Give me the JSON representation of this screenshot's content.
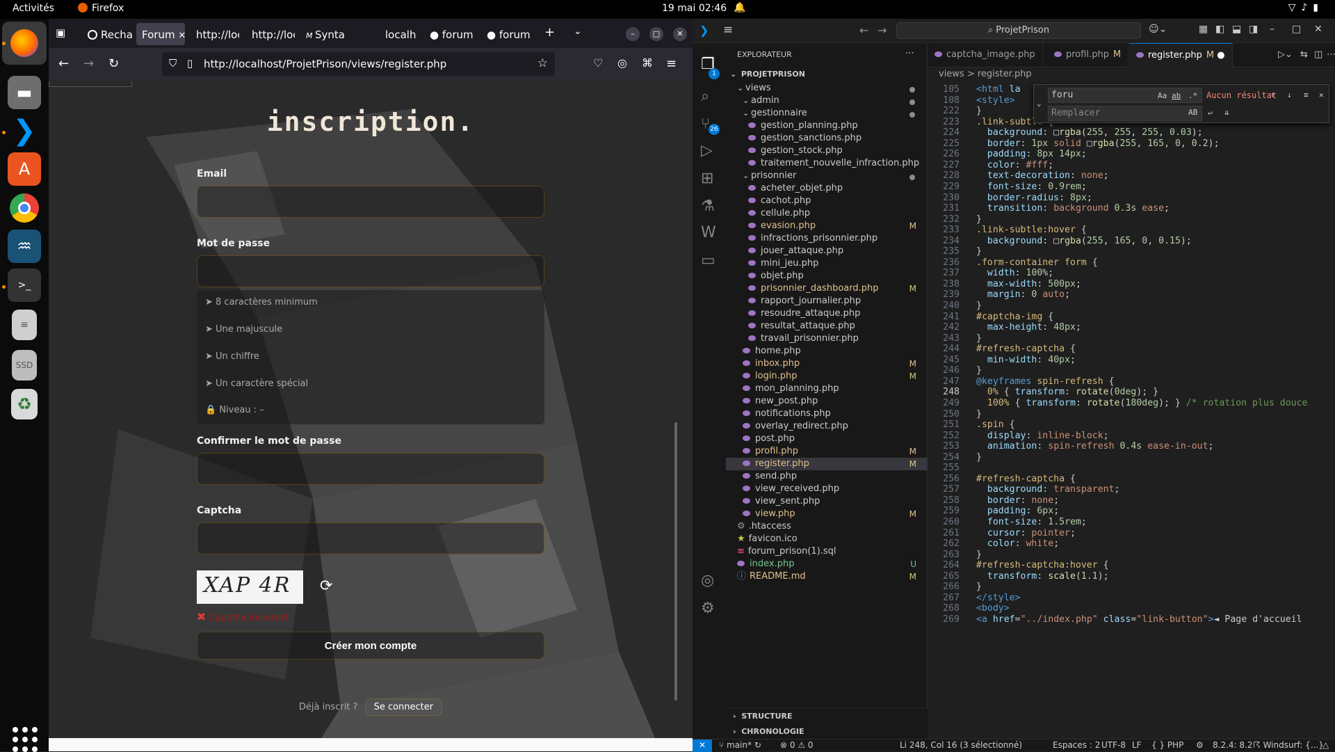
{
  "topbar": {
    "activities": "Activités",
    "app": "Firefox",
    "clock": "19 mai  02:46"
  },
  "firefox": {
    "tabs": [
      {
        "label": "Recha"
      },
      {
        "label": "Forum"
      },
      {
        "label": "http://loc"
      },
      {
        "label": "http://loc"
      },
      {
        "label": "Synta"
      },
      {
        "label": "localh"
      },
      {
        "label": "forum"
      },
      {
        "label": "forum"
      }
    ],
    "url": "http://localhost/ProjetPrison/views/register.php"
  },
  "page": {
    "title": "inscription.",
    "email_label": "Email",
    "password_label": "Mot de passe",
    "rules": [
      "8 caractères minimum",
      "Une majuscule",
      "Un chiffre",
      "Un caractère spécial"
    ],
    "level": "Niveau : –",
    "confirm_label": "Confirmer le mot de passe",
    "captcha_label": "Captcha",
    "captcha_text": "XAP 4R",
    "captcha_error": "Captcha incorrect",
    "submit": "Créer mon compte",
    "already": "Déjà inscrit ?",
    "login_link": "Se connecter"
  },
  "vscode": {
    "search": "ProjetPrison",
    "explorer_title": "EXPLORATEUR",
    "project": "PROJETPRISON",
    "tree": [
      {
        "name": "views",
        "type": "folder",
        "indent": 1
      },
      {
        "name": "admin",
        "type": "folder",
        "indent": 2
      },
      {
        "name": "gestionnaire",
        "type": "folder",
        "indent": 2
      },
      {
        "name": "gestion_planning.php",
        "indent": 3
      },
      {
        "name": "gestion_sanctions.php",
        "indent": 3
      },
      {
        "name": "gestion_stock.php",
        "indent": 3
      },
      {
        "name": "traitement_nouvelle_infraction.php",
        "indent": 3
      },
      {
        "name": "prisonnier",
        "type": "folder",
        "indent": 2
      },
      {
        "name": "acheter_objet.php",
        "indent": 3
      },
      {
        "name": "cachot.php",
        "indent": 3
      },
      {
        "name": "cellule.php",
        "indent": 3
      },
      {
        "name": "evasion.php",
        "indent": 3,
        "status": "M"
      },
      {
        "name": "infractions_prisonnier.php",
        "indent": 3
      },
      {
        "name": "jouer_attaque.php",
        "indent": 3
      },
      {
        "name": "mini_jeu.php",
        "indent": 3
      },
      {
        "name": "objet.php",
        "indent": 3
      },
      {
        "name": "prisonnier_dashboard.php",
        "indent": 3,
        "status": "M"
      },
      {
        "name": "rapport_journalier.php",
        "indent": 3
      },
      {
        "name": "resoudre_attaque.php",
        "indent": 3
      },
      {
        "name": "resultat_attaque.php",
        "indent": 3
      },
      {
        "name": "travail_prisonnier.php",
        "indent": 3
      },
      {
        "name": "home.php",
        "indent": 2
      },
      {
        "name": "inbox.php",
        "indent": 2,
        "status": "M"
      },
      {
        "name": "login.php",
        "indent": 2,
        "status": "M"
      },
      {
        "name": "mon_planning.php",
        "indent": 2
      },
      {
        "name": "new_post.php",
        "indent": 2
      },
      {
        "name": "notifications.php",
        "indent": 2
      },
      {
        "name": "overlay_redirect.php",
        "indent": 2
      },
      {
        "name": "post.php",
        "indent": 2
      },
      {
        "name": "profil.php",
        "indent": 2,
        "status": "M"
      },
      {
        "name": "register.php",
        "indent": 2,
        "status": "M",
        "selected": true
      },
      {
        "name": "send.php",
        "indent": 2
      },
      {
        "name": "view_received.php",
        "indent": 2
      },
      {
        "name": "view_sent.php",
        "indent": 2
      },
      {
        "name": "view.php",
        "indent": 2,
        "status": "M"
      },
      {
        "name": ".htaccess",
        "indent": 1
      },
      {
        "name": "favicon.ico",
        "indent": 1
      },
      {
        "name": "forum_prison(1).sql",
        "indent": 1
      },
      {
        "name": "index.php",
        "indent": 1,
        "status": "U"
      },
      {
        "name": "README.md",
        "indent": 1,
        "status": "M"
      }
    ],
    "editor_tabs": [
      {
        "label": "captcha_image.php"
      },
      {
        "label": "profil.php",
        "mod": "M"
      },
      {
        "label": "register.php",
        "mod": "M"
      }
    ],
    "breadcrumb": "views  >  register.php",
    "find": {
      "query": "foru",
      "replace": "Remplacer",
      "result": "Aucun résultat"
    },
    "sections": [
      "STRUCTURE",
      "CHRONOLOGIE"
    ],
    "status": {
      "branch": "main*",
      "problems": "0 ⚠ 0",
      "position": "Li 248, Col 16 (3 sélectionné)",
      "spaces": "Espaces : 2",
      "encoding": "UTF-8",
      "eol": "LF",
      "lang": "{ } PHP",
      "version": "8.2.4: 8.2",
      "windsurf": "Windsurf: {...}"
    },
    "code": [
      {
        "n": "105",
        "html": "<span class=\"t\">&lt;html</span> <span class=\"p\">la</span>"
      },
      {
        "n": "108",
        "html": "<span class=\"t\">&lt;style&gt;</span>"
      },
      {
        "n": "222",
        "html": "}"
      },
      {
        "n": "223",
        "html": "<span class=\"k\">.link-subtle</span> {"
      },
      {
        "n": "224",
        "html": "  <span class=\"p\">background</span>: □<span class=\"f\">rgba</span>(<span class=\"n\">255</span>, <span class=\"n\">255</span>, <span class=\"n\">255</span>, <span class=\"n\">0.03</span>);"
      },
      {
        "n": "225",
        "html": "  <span class=\"p\">border</span>: <span class=\"n\">1px</span> <span class=\"v\">solid</span> □<span class=\"f\">rgba</span>(<span class=\"n\">255</span>, <span class=\"n\">165</span>, <span class=\"n\">0</span>, <span class=\"n\">0.2</span>);"
      },
      {
        "n": "226",
        "html": "  <span class=\"p\">padding</span>: <span class=\"n\">8px 14px</span>;"
      },
      {
        "n": "227",
        "html": "  <span class=\"p\">color</span>: <span class=\"v\">#fff</span>;"
      },
      {
        "n": "228",
        "html": "  <span class=\"p\">text-decoration</span>: <span class=\"v\">none</span>;"
      },
      {
        "n": "229",
        "html": "  <span class=\"p\">font-size</span>: <span class=\"n\">0.9rem</span>;"
      },
      {
        "n": "230",
        "html": "  <span class=\"p\">border-radius</span>: <span class=\"n\">8px</span>;"
      },
      {
        "n": "231",
        "html": "  <span class=\"p\">transition</span>: <span class=\"v\">background</span> <span class=\"n\">0.3s</span> <span class=\"v\">ease</span>;"
      },
      {
        "n": "232",
        "html": "}"
      },
      {
        "n": "233",
        "html": "<span class=\"k\">.link-subtle:hover</span> {"
      },
      {
        "n": "234",
        "html": "  <span class=\"p\">background</span>: □<span class=\"f\">rgba</span>(<span class=\"n\">255</span>, <span class=\"n\">165</span>, <span class=\"n\">0</span>, <span class=\"n\">0.15</span>);"
      },
      {
        "n": "235",
        "html": "}"
      },
      {
        "n": "236",
        "html": "<span class=\"k\">.form-container form</span> {"
      },
      {
        "n": "237",
        "html": "  <span class=\"p\">width</span>: <span class=\"n\">100%</span>;"
      },
      {
        "n": "238",
        "html": "  <span class=\"p\">max-width</span>: <span class=\"n\">500px</span>;"
      },
      {
        "n": "239",
        "html": "  <span class=\"p\">margin</span>: <span class=\"n\">0</span> <span class=\"v\">auto</span>;"
      },
      {
        "n": "240",
        "html": "}"
      },
      {
        "n": "241",
        "html": "<span class=\"k\">#captcha-img</span> {"
      },
      {
        "n": "242",
        "html": "  <span class=\"p\">max-height</span>: <span class=\"n\">48px</span>;"
      },
      {
        "n": "243",
        "html": "}"
      },
      {
        "n": "244",
        "html": "<span class=\"k\">#refresh-captcha</span> {"
      },
      {
        "n": "245",
        "html": "  <span class=\"p\">min-width</span>: <span class=\"n\">40px</span>;"
      },
      {
        "n": "246",
        "html": "}"
      },
      {
        "n": "247",
        "html": "<span class=\"t\">@keyframes</span> <span class=\"k\">spin-refresh</span> {"
      },
      {
        "n": "248",
        "html": "  <span class=\"k\">0%</span> { <span class=\"p\">transform</span>: <span class=\"f\">rotate</span>(<span class=\"n\">0deg</span>); }",
        "cur": true
      },
      {
        "n": "249",
        "html": "  <span class=\"k\">100%</span> { <span class=\"p\">transform</span>: <span class=\"f\">rotate</span>(<span class=\"n\">180deg</span>); } <span class=\"c\">/* rotation plus douce</span>"
      },
      {
        "n": "250",
        "html": "}"
      },
      {
        "n": "251",
        "html": "<span class=\"k\">.spin</span> {"
      },
      {
        "n": "252",
        "html": "  <span class=\"p\">display</span>: <span class=\"v\">inline-block</span>;"
      },
      {
        "n": "253",
        "html": "  <span class=\"p\">animation</span>: <span class=\"v\">spin-refresh</span> <span class=\"n\">0.4s</span> <span class=\"v\">ease-in-out</span>;"
      },
      {
        "n": "254",
        "html": "}"
      },
      {
        "n": "255",
        "html": ""
      },
      {
        "n": "256",
        "html": "<span class=\"k\">#refresh-captcha</span> {"
      },
      {
        "n": "257",
        "html": "  <span class=\"p\">background</span>: <span class=\"v\">transparent</span>;"
      },
      {
        "n": "258",
        "html": "  <span class=\"p\">border</span>: <span class=\"v\">none</span>;"
      },
      {
        "n": "259",
        "html": "  <span class=\"p\">padding</span>: <span class=\"n\">6px</span>;"
      },
      {
        "n": "260",
        "html": "  <span class=\"p\">font-size</span>: <span class=\"n\">1.5rem</span>;"
      },
      {
        "n": "261",
        "html": "  <span class=\"p\">cursor</span>: <span class=\"v\">pointer</span>;"
      },
      {
        "n": "262",
        "html": "  <span class=\"p\">color</span>: <span class=\"v\">white</span>;"
      },
      {
        "n": "263",
        "html": "}"
      },
      {
        "n": "264",
        "html": "<span class=\"k\">#refresh-captcha:hover</span> {"
      },
      {
        "n": "265",
        "html": "  <span class=\"p\">transform</span>: <span class=\"f\">scale</span>(<span class=\"n\">1.1</span>);"
      },
      {
        "n": "266",
        "html": "}"
      },
      {
        "n": "267",
        "html": "<span class=\"t\">&lt;/style&gt;</span>"
      },
      {
        "n": "268",
        "html": "<span class=\"t\">&lt;body&gt;</span>"
      },
      {
        "n": "269",
        "html": "<span class=\"t\">&lt;a</span> <span class=\"p\">href</span>=<span class=\"v\">\"../index.php\"</span> <span class=\"p\">class</span>=<span class=\"v\">\"link-button\"</span><span class=\"t\">&gt;</span>◄ Page d'accueil"
      }
    ]
  }
}
